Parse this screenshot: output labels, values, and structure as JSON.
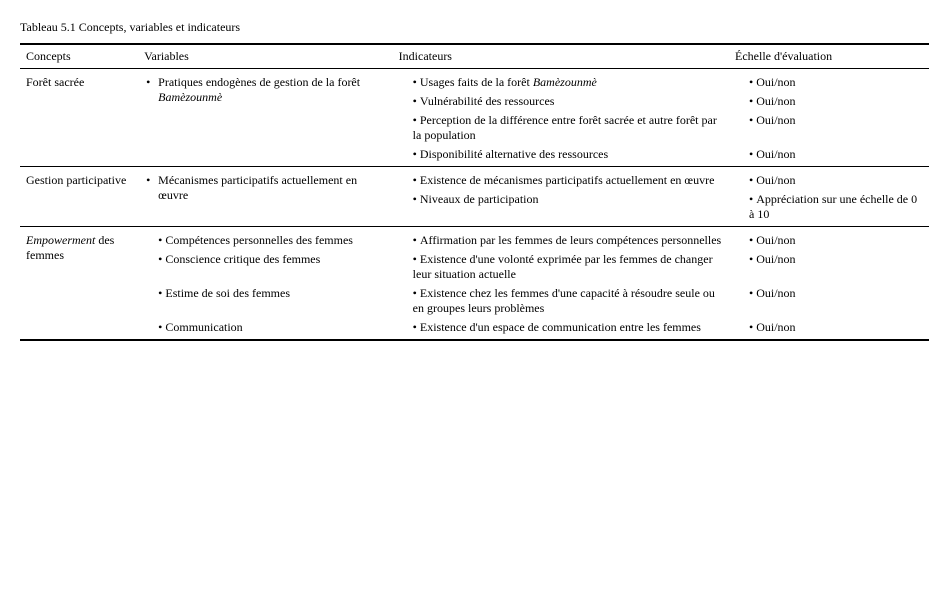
{
  "title": "Tableau 5.1    Concepts, variables et indicateurs",
  "headers": {
    "concepts": "Concepts",
    "variables": "Variables",
    "indicateurs": "Indicateurs",
    "echelle": "Échelle d'évaluation"
  },
  "sections": [
    {
      "concept": "Forêt sacrée",
      "variables": [
        {
          "text": "Pratiques endogènes de gestion de la forêt ",
          "italic_suffix": "Bamèzounmè"
        }
      ],
      "indicateurs": [
        {
          "text": "Usages faits de la forêt ",
          "italic_suffix": "Bamèzounmè"
        },
        {
          "text": "Vulnérabilité des ressources",
          "italic_suffix": ""
        },
        {
          "text": "Perception de la différence entre forêt sacrée et autre forêt par la population",
          "italic_suffix": ""
        },
        {
          "text": "Disponibilité alternative des ressources",
          "italic_suffix": ""
        }
      ],
      "echelle": [
        "Oui/non",
        "Oui/non",
        "Oui/non",
        "Oui/non"
      ]
    },
    {
      "concept": "Gestion participative",
      "variables": [
        {
          "text": "Mécanismes participatifs actuellement en œuvre",
          "italic_suffix": ""
        }
      ],
      "indicateurs": [
        {
          "text": "Existence de mécanismes participatifs actuellement en œuvre",
          "italic_suffix": ""
        },
        {
          "text": "Niveaux de participation",
          "italic_suffix": ""
        }
      ],
      "echelle": [
        "Oui/non",
        "Appréciation sur une échelle de 0 à 10"
      ]
    },
    {
      "concept_italic": "Empowerment",
      "concept_suffix": " des femmes",
      "variables": [
        {
          "text": "Compétences personnelles des femmes",
          "italic_suffix": ""
        },
        {
          "text": "Conscience critique des femmes",
          "italic_suffix": ""
        },
        {
          "text": "Estime de soi des femmes",
          "italic_suffix": ""
        },
        {
          "text": "Communication",
          "italic_suffix": ""
        }
      ],
      "indicateurs": [
        {
          "text": "Affirmation par les femmes de leurs compétences personnelles",
          "italic_suffix": ""
        },
        {
          "text": "Existence d'une volonté exprimée par les femmes de changer leur situation actuelle",
          "italic_suffix": ""
        },
        {
          "text": "Existence chez les femmes d'une capacité à résoudre seule ou en groupes leurs problèmes",
          "italic_suffix": ""
        },
        {
          "text": "Existence d'un espace de communication entre les femmes",
          "italic_suffix": ""
        }
      ],
      "echelle": [
        "Oui/non",
        "Oui/non",
        "Oui/non",
        "Oui/non"
      ]
    }
  ]
}
